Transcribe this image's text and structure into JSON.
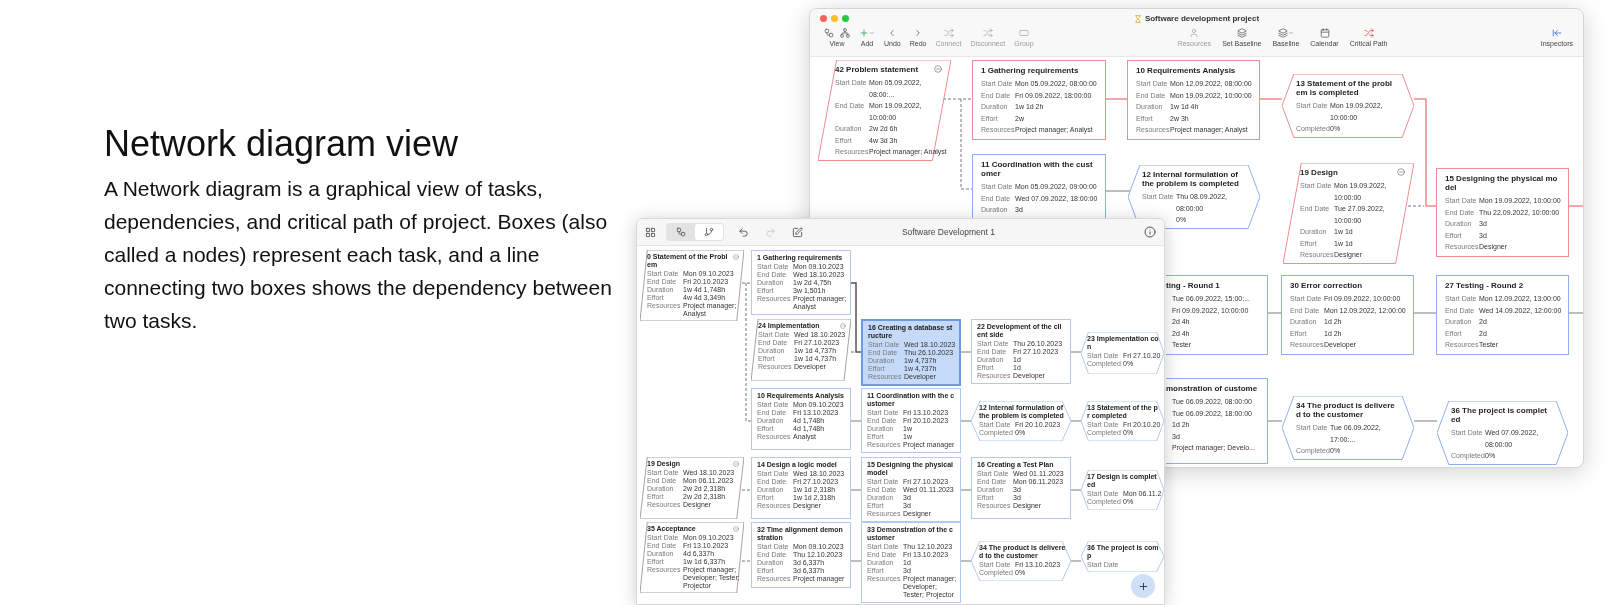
{
  "page": {
    "heading": "Network diagram view",
    "paragraph": "A Network diagram is a graphical view of tasks, dependencies, and critical path of project. Boxes (also called a nodes) represent each task, and a line connecting two boxes shows the dependency between two tasks."
  },
  "main_window": {
    "title": "Software development project",
    "toolbar": [
      {
        "label": "View",
        "disabled": false
      },
      {
        "label": "Add",
        "disabled": false
      },
      {
        "label": "Undo",
        "disabled": false
      },
      {
        "label": "Redo",
        "disabled": false
      },
      {
        "label": "Connect",
        "disabled": true
      },
      {
        "label": "Disconnect",
        "disabled": true
      },
      {
        "label": "Group",
        "disabled": true
      },
      {
        "label": "Resources",
        "disabled": true
      },
      {
        "label": "Set Baseline",
        "disabled": false
      },
      {
        "label": "Baseline",
        "disabled": false
      },
      {
        "label": "Calendar",
        "disabled": false
      },
      {
        "label": "Critical Path",
        "disabled": false
      },
      {
        "label": "Inspectors",
        "disabled": false
      }
    ],
    "nodes": [
      {
        "kind": "summary",
        "critical": true,
        "title": "42 Problem statement",
        "fields": [
          {
            "label": "Start Date",
            "value": "Mon 05.09.2022, 08:00:..."
          },
          {
            "label": "End Date",
            "value": "Mon 19.09.2022, 10:00:00"
          },
          {
            "label": "Duration",
            "value": "2w 2d 6h"
          },
          {
            "label": "Effort",
            "value": "4w 3d 3h"
          },
          {
            "label": "Resources",
            "value": "Project manager; Analyst"
          }
        ]
      },
      {
        "kind": "task",
        "critical": true,
        "title": "1 Gathering requirements",
        "fields": [
          {
            "label": "Start Date",
            "value": "Mon 05.09.2022, 08:00:00"
          },
          {
            "label": "End Date",
            "value": "Fri 09.09.2022, 18:00:00"
          },
          {
            "label": "Duration",
            "value": "1w 1d 2h"
          },
          {
            "label": "Effort",
            "value": "2w"
          },
          {
            "label": "Resources",
            "value": "Project manager; Analyst"
          }
        ]
      },
      {
        "kind": "task",
        "critical": true,
        "title": "10 Requirements Analysis",
        "fields": [
          {
            "label": "Start Date",
            "value": "Mon 12.09.2022, 08:00:00"
          },
          {
            "label": "End Date",
            "value": "Mon 19.09.2022, 10:00:00"
          },
          {
            "label": "Duration",
            "value": "1w 1d 4h"
          },
          {
            "label": "Effort",
            "value": "2w 3h"
          },
          {
            "label": "Resources",
            "value": "Project manager; Analyst"
          }
        ]
      },
      {
        "kind": "milestone",
        "critical": true,
        "title": "13 Statement of the problem is completed",
        "fields": [
          {
            "label": "Start Date",
            "value": "Mon 19.09.2022, 10:00:00"
          },
          {
            "label": "Completed",
            "value": "0%"
          }
        ]
      },
      {
        "kind": "task",
        "critical": false,
        "title": "11 Coordination with the customer",
        "fields": [
          {
            "label": "Start Date",
            "value": "Mon 05.09.2022, 09:00:00"
          },
          {
            "label": "End Date",
            "value": "Wed 07.09.2022, 18:00:00"
          },
          {
            "label": "Duration",
            "value": "3d"
          }
        ]
      },
      {
        "kind": "milestone",
        "critical": false,
        "title": "12 Internal formulation of the problem is completed",
        "fields": [
          {
            "label": "Start Date",
            "value": "Thu 08.09.2022, 08:00:00"
          },
          {
            "value": "0%"
          }
        ]
      },
      {
        "kind": "summary",
        "critical": true,
        "title": "19 Design",
        "fields": [
          {
            "label": "Start Date",
            "value": "Mon 19.09.2022, 10:00:00"
          },
          {
            "label": "End Date",
            "value": "Tue 27.09.2022, 10:00:00"
          },
          {
            "label": "Duration",
            "value": "1w 1d"
          },
          {
            "label": "Effort",
            "value": "1w 1d"
          },
          {
            "label": "Resources",
            "value": "Designer"
          }
        ]
      },
      {
        "kind": "task",
        "critical": true,
        "title": "15 Designing the physical model",
        "fields": [
          {
            "label": "Start Date",
            "value": "Mon 19.09.2022, 10:00:00"
          },
          {
            "label": "End Date",
            "value": "Thu 22.09.2022, 10:00:00"
          },
          {
            "label": "Duration",
            "value": "3d"
          },
          {
            "label": "Effort",
            "value": "3d"
          },
          {
            "label": "Resources",
            "value": "Designer"
          }
        ]
      },
      {
        "kind": "task",
        "critical": false,
        "title": "ting - Round 1",
        "fields": [
          {
            "value": "Tue 06.09.2022, 15:00:..."
          },
          {
            "value": "Fri 09.09.2022, 10:00:00"
          },
          {
            "value": "2d 4h"
          },
          {
            "value": "2d 4h"
          },
          {
            "value": "Tester"
          }
        ]
      },
      {
        "kind": "task",
        "critical": false,
        "title": "30 Error correction",
        "fields": [
          {
            "label": "Start Date",
            "value": "Fri 09.09.2022, 10:00:00"
          },
          {
            "label": "End Date",
            "value": "Mon 12.09.2022, 12:00:00"
          },
          {
            "label": "Duration",
            "value": "1d 2h"
          },
          {
            "label": "Effort",
            "value": "1d 2h"
          },
          {
            "label": "Resources",
            "value": "Developer"
          }
        ]
      },
      {
        "kind": "task",
        "critical": false,
        "title": "27 Testing - Round 2",
        "fields": [
          {
            "label": "Start Date",
            "value": "Mon 12.09.2022, 13:00:00"
          },
          {
            "label": "End Date",
            "value": "Wed 14.09.2022, 12:00:00"
          },
          {
            "label": "Duration",
            "value": "2d"
          },
          {
            "label": "Effort",
            "value": "2d"
          },
          {
            "label": "Resources",
            "value": "Tester"
          }
        ]
      },
      {
        "kind": "task",
        "critical": false,
        "title": "monstration of custome",
        "fields": [
          {
            "value": "Tue 06.09.2022, 08:00:00"
          },
          {
            "value": "Tue 06.09.2022, 18:00:00"
          },
          {
            "value": "1d 2h"
          },
          {
            "value": "3d"
          },
          {
            "value": "Project manager; Develo..."
          }
        ]
      },
      {
        "kind": "milestone",
        "critical": false,
        "title": "34 The product is delivered to the customer",
        "fields": [
          {
            "label": "Start Date",
            "value": "Tue 06.09.2022, 17:00:..."
          },
          {
            "label": "Completed",
            "value": "0%"
          }
        ]
      },
      {
        "kind": "milestone",
        "critical": false,
        "title": "36 The project is completed",
        "fields": [
          {
            "label": "Start Date",
            "value": "Wed 07.09.2022, 08:00:00"
          },
          {
            "label": "Completed",
            "value": "0%"
          }
        ]
      }
    ]
  },
  "second_window": {
    "title": "Software Development 1",
    "view_switch": [
      {
        "selected": false
      },
      {
        "selected": true
      }
    ],
    "redo_disabled": true,
    "nodes": [
      {
        "kind": "summary",
        "selected": false,
        "title": "0 Statement of the Problem",
        "fields": [
          {
            "label": "Start Date",
            "value": "Mon 09.10.2023"
          },
          {
            "label": "End Date",
            "value": "Fri 20.10.2023"
          },
          {
            "label": "Duration",
            "value": "1w 4d 1,748h"
          },
          {
            "label": "Effort",
            "value": "4w 4d 3,349h"
          },
          {
            "label": "Resources",
            "value": "Project manager; Analyst"
          }
        ]
      },
      {
        "kind": "task",
        "selected": false,
        "title": "1 Gathering requirements",
        "fields": [
          {
            "label": "Start Date",
            "value": "Mon 09.10.2023"
          },
          {
            "label": "End Date",
            "value": "Wed 18.10.2023"
          },
          {
            "label": "Duration",
            "value": "1w 2d 4,75h"
          },
          {
            "label": "Effort",
            "value": "3w 1,501h"
          },
          {
            "label": "Resources",
            "value": "Project manager; Analyst"
          }
        ]
      },
      {
        "kind": "summary",
        "selected": false,
        "title": "24 Implementation",
        "fields": [
          {
            "label": "Start Date",
            "value": "Wed 18.10.2023"
          },
          {
            "label": "End Date",
            "value": "Fri 27.10.2023"
          },
          {
            "label": "Duration",
            "value": "1w 1d 4,737h"
          },
          {
            "label": "Effort",
            "value": "1w 1d 4,737h"
          },
          {
            "label": "Resources",
            "value": "Developer"
          }
        ]
      },
      {
        "kind": "task",
        "selected": true,
        "title": "16 Creating a database structure",
        "fields": [
          {
            "label": "Start Date",
            "value": "Wed 18.10.2023"
          },
          {
            "label": "End Date",
            "value": "Thu 26.10.2023"
          },
          {
            "label": "Duration",
            "value": "1w 4,737h"
          },
          {
            "label": "Effort",
            "value": "1w 4,737h"
          },
          {
            "label": "Resources",
            "value": "Developer"
          }
        ]
      },
      {
        "kind": "task",
        "selected": false,
        "title": "22 Development of the client side",
        "fields": [
          {
            "label": "Start Date",
            "value": "Thu 26.10.2023"
          },
          {
            "label": "End Date",
            "value": "Fri 27.10.2023"
          },
          {
            "label": "Duration",
            "value": "1d"
          },
          {
            "label": "Effort",
            "value": "1d"
          },
          {
            "label": "Resources",
            "value": "Developer"
          }
        ]
      },
      {
        "kind": "milestone",
        "selected": false,
        "title": "23 Implementation con",
        "fields": [
          {
            "label": "Start Date",
            "value": "Fri 27.10.20"
          },
          {
            "label": "Completed",
            "value": "0%"
          }
        ]
      },
      {
        "kind": "task",
        "selected": false,
        "title": "10 Requirements Analysis",
        "fields": [
          {
            "label": "Start Date",
            "value": "Mon 09.10.2023"
          },
          {
            "label": "End Date",
            "value": "Fri 13.10.2023"
          },
          {
            "label": "Duration",
            "value": "4d 1,748h"
          },
          {
            "label": "Effort",
            "value": "4d 1,748h"
          },
          {
            "label": "Resources",
            "value": "Analyst"
          }
        ]
      },
      {
        "kind": "task",
        "selected": false,
        "title": "11 Coordination with the customer",
        "fields": [
          {
            "label": "Start Date",
            "value": "Fri 13.10.2023"
          },
          {
            "label": "End Date",
            "value": "Fri 20.10.2023"
          },
          {
            "label": "Duration",
            "value": "1w"
          },
          {
            "label": "Effort",
            "value": "1w"
          },
          {
            "label": "Resources",
            "value": "Project manager"
          }
        ]
      },
      {
        "kind": "milestone",
        "selected": false,
        "title": "12 Internal formulation of the problem is completed",
        "fields": [
          {
            "label": "Start Date",
            "value": "Fri 20.10.2023"
          },
          {
            "label": "Completed",
            "value": "0%"
          }
        ]
      },
      {
        "kind": "milestone",
        "selected": false,
        "title": "13 Statement of the pr completed",
        "fields": [
          {
            "label": "Start Date",
            "value": "Fri 20.10.20"
          },
          {
            "label": "Completed",
            "value": "0%"
          }
        ]
      },
      {
        "kind": "summary",
        "selected": false,
        "title": "19 Design",
        "fields": [
          {
            "label": "Start Date",
            "value": "Wed 18.10.2023"
          },
          {
            "label": "End Date",
            "value": "Mon 06.11.2023"
          },
          {
            "label": "Duration",
            "value": "2w 2d 2,318h"
          },
          {
            "label": "Effort",
            "value": "2w 2d 2,318h"
          },
          {
            "label": "Resources",
            "value": "Designer"
          }
        ]
      },
      {
        "kind": "task",
        "selected": false,
        "title": "14 Design a logic model",
        "fields": [
          {
            "label": "Start Date",
            "value": "Wed 18.10.2023"
          },
          {
            "label": "End Date",
            "value": "Fri 27.10.2023"
          },
          {
            "label": "Duration",
            "value": "1w 1d 2,318h"
          },
          {
            "label": "Effort",
            "value": "1w 1d 2,318h"
          },
          {
            "label": "Resources",
            "value": "Designer"
          }
        ]
      },
      {
        "kind": "task",
        "selected": false,
        "title": "15 Designing the physical model",
        "fields": [
          {
            "label": "Start Date",
            "value": "Fri 27.10.2023"
          },
          {
            "label": "End Date",
            "value": "Wed 01.11.2023"
          },
          {
            "label": "Duration",
            "value": "3d"
          },
          {
            "label": "Effort",
            "value": "3d"
          },
          {
            "label": "Resources",
            "value": "Designer"
          }
        ]
      },
      {
        "kind": "task",
        "selected": false,
        "title": "16 Creating a Test Plan",
        "fields": [
          {
            "label": "Start Date",
            "value": "Wed 01.11.2023"
          },
          {
            "label": "End Date",
            "value": "Mon 06.11.2023"
          },
          {
            "label": "Duration",
            "value": "3d"
          },
          {
            "label": "Effort",
            "value": "3d"
          },
          {
            "label": "Resources",
            "value": "Designer"
          }
        ]
      },
      {
        "kind": "milestone",
        "selected": false,
        "title": "17 Design is completed",
        "fields": [
          {
            "label": "Start Date",
            "value": "Mon 06.11.2"
          },
          {
            "label": "Completed",
            "value": "0%"
          }
        ]
      },
      {
        "kind": "summary",
        "selected": false,
        "title": "35 Acceptance",
        "fields": [
          {
            "label": "Start Date",
            "value": "Mon 09.10.2023"
          },
          {
            "label": "End Date",
            "value": "Fri 13.10.2023"
          },
          {
            "label": "Duration",
            "value": "4d 6,337h"
          },
          {
            "label": "Effort",
            "value": "1w 1d 6,337h"
          },
          {
            "label": "Resources",
            "value": "Project manager; Developer; Tester; Projector"
          }
        ]
      },
      {
        "kind": "task",
        "selected": false,
        "title": "32 Time alignment demonstration",
        "fields": [
          {
            "label": "Start Date",
            "value": "Mon 09.10.2023"
          },
          {
            "label": "End Date",
            "value": "Thu 12.10.2023"
          },
          {
            "label": "Duration",
            "value": "3d 6,337h"
          },
          {
            "label": "Effort",
            "value": "3d 6,337h"
          },
          {
            "label": "Resources",
            "value": "Project manager"
          }
        ]
      },
      {
        "kind": "task",
        "selected": false,
        "title": "33 Demonstration of the customer",
        "fields": [
          {
            "label": "Start Date",
            "value": "Thu 12.10.2023"
          },
          {
            "label": "End Date",
            "value": "Fri 13.10.2023"
          },
          {
            "label": "Duration",
            "value": "1d"
          },
          {
            "label": "Effort",
            "value": "3d"
          },
          {
            "label": "Resources",
            "value": "Project manager; Developer; Tester; Projector"
          }
        ]
      },
      {
        "kind": "milestone",
        "selected": false,
        "title": "34 The product is delivered to the customer",
        "fields": [
          {
            "label": "Start Date",
            "value": "Fri 13.10.2023"
          },
          {
            "label": "Completed",
            "value": "0%"
          }
        ]
      },
      {
        "kind": "milestone",
        "selected": false,
        "title": "36 The project is comp",
        "fields": [
          {
            "label": "Start Date"
          }
        ]
      }
    ]
  }
}
